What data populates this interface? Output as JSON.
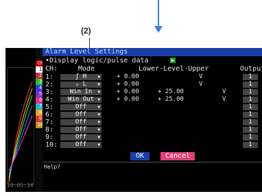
{
  "annotations": {
    "label": "(2)"
  },
  "left_panel": {
    "ch_label": "CH",
    "channels": [
      "1",
      "2",
      "3",
      "4",
      "5",
      "6",
      "7",
      "8",
      "9",
      "10"
    ],
    "time": "10:05:34"
  },
  "dialog": {
    "title": "Alarm Level Settings",
    "subtitle": "•Display logic/pulse data",
    "header_ch": "CH:",
    "header_mode": "Mode",
    "header_levels": "Lower-Level-Upper",
    "header_output": "Output",
    "rows": [
      {
        "ch": "1:",
        "mode": "ʃ H",
        "lower": "+ 0.00",
        "upper": "",
        "unit": "V",
        "output": "1"
      },
      {
        "ch": "2:",
        "mode": "ₒ L",
        "lower": "+ 0.00",
        "upper": "",
        "unit": "V",
        "output": "1"
      },
      {
        "ch": "3:",
        "mode": "Win In",
        "lower": "+ 0.00",
        "upper": "+ 25.00",
        "unit": "V",
        "output": "1"
      },
      {
        "ch": "4:",
        "mode": "Win Out",
        "lower": "+ 0.00",
        "upper": "+ 25.00",
        "unit": "V",
        "output": "1"
      },
      {
        "ch": "5:",
        "mode": "Off",
        "lower": "",
        "upper": "",
        "unit": "",
        "output": "1"
      },
      {
        "ch": "6:",
        "mode": "Off",
        "lower": "",
        "upper": "",
        "unit": "",
        "output": "1"
      },
      {
        "ch": "7:",
        "mode": "Off",
        "lower": "",
        "upper": "",
        "unit": "",
        "output": "1"
      },
      {
        "ch": "8:",
        "mode": "Off",
        "lower": "",
        "upper": "",
        "unit": "",
        "output": "1"
      },
      {
        "ch": "9:",
        "mode": "Off",
        "lower": "",
        "upper": "",
        "unit": "",
        "output": "1"
      },
      {
        "ch": "10:",
        "mode": "Off",
        "lower": "",
        "upper": "",
        "unit": "",
        "output": "1"
      }
    ],
    "ok_label": "OK",
    "cancel_label": "Cancel",
    "help_label": "Help?"
  }
}
